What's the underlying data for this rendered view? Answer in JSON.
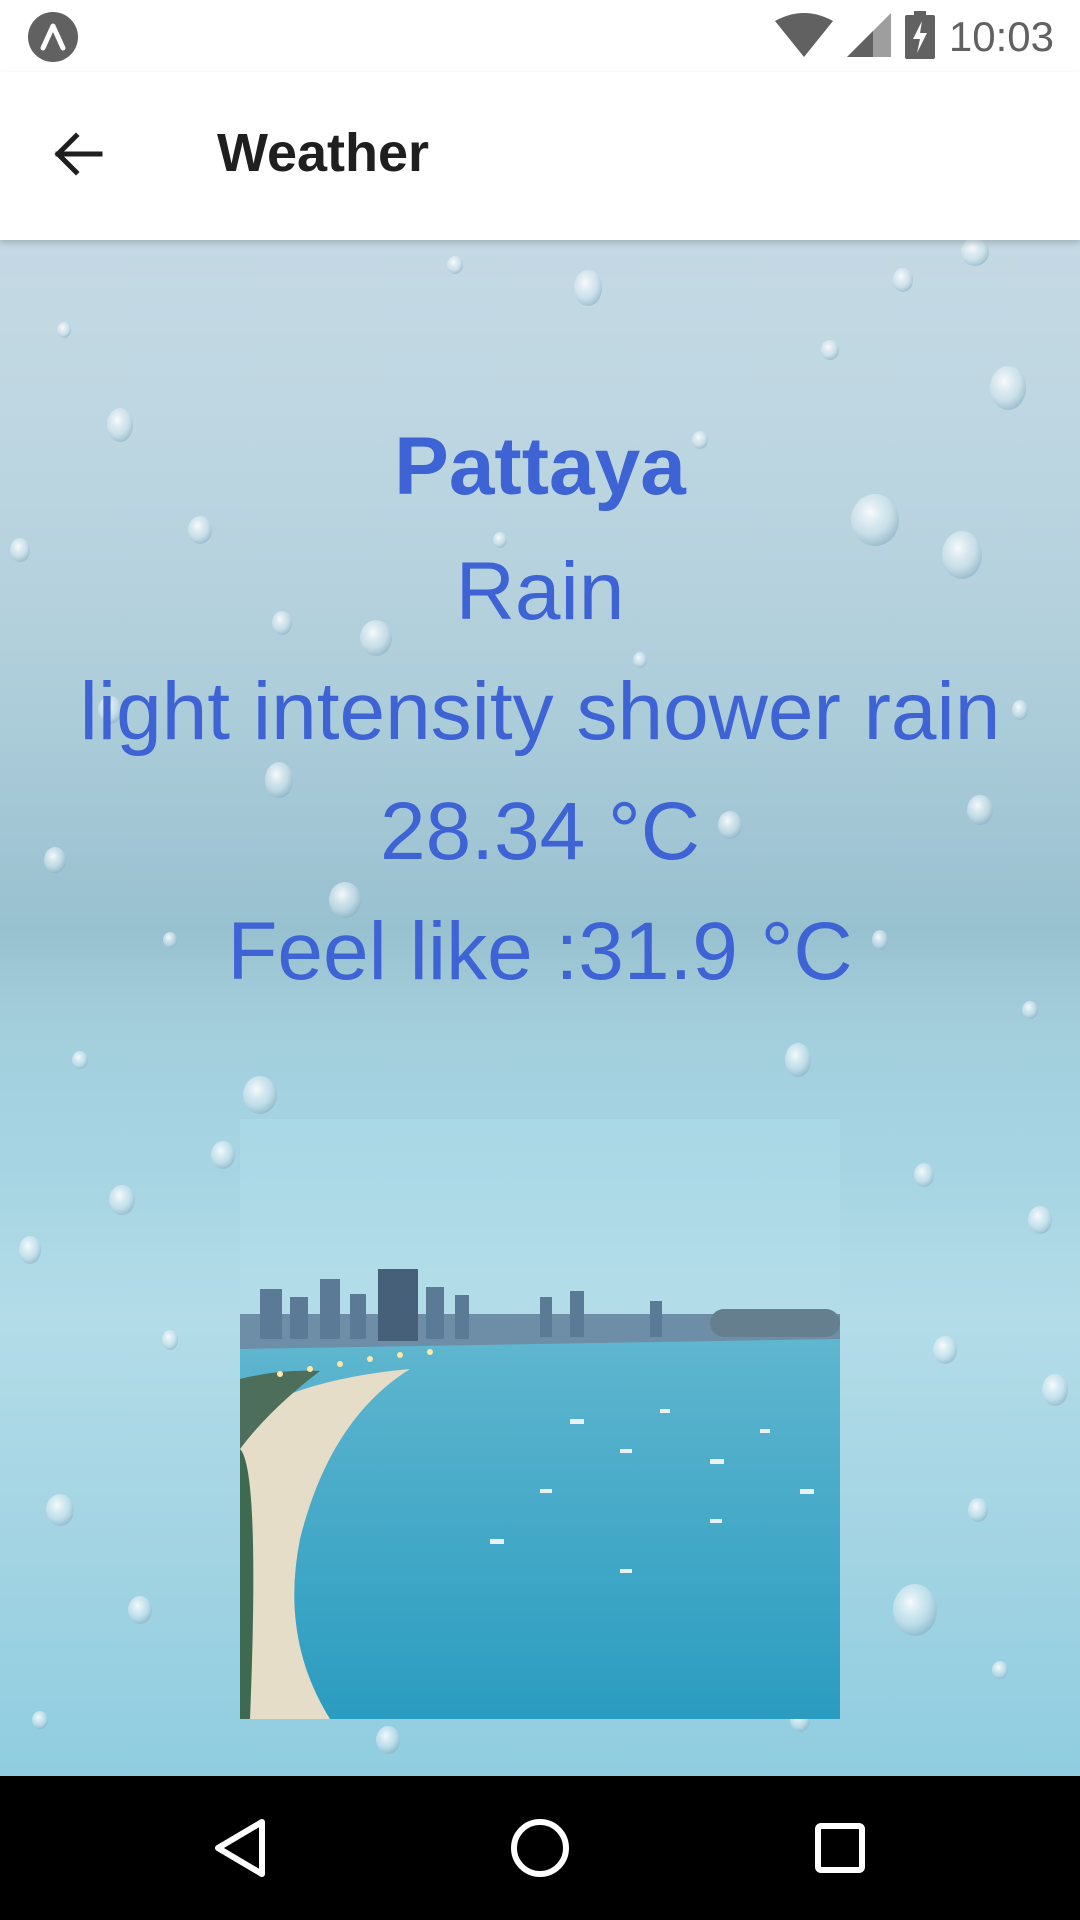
{
  "status_bar": {
    "time": "10:03",
    "icons": [
      "app-logo-icon",
      "wifi-icon",
      "cellular-signal-icon",
      "battery-charging-icon"
    ]
  },
  "app_bar": {
    "title": "Weather",
    "back_icon": "arrow-back-icon"
  },
  "weather": {
    "city": "Pattaya",
    "main": "Rain",
    "description": "light intensity shower rain",
    "temperature": "28.34 °C",
    "feels_like": "Feel like :31.9 °C"
  },
  "colors": {
    "text_accent": "#3d63d4",
    "app_bar_bg": "#ffffff",
    "nav_bar_bg": "#000000"
  },
  "nav_bar": {
    "icons": [
      "back-triangle-icon",
      "home-circle-icon",
      "recents-square-icon"
    ]
  }
}
